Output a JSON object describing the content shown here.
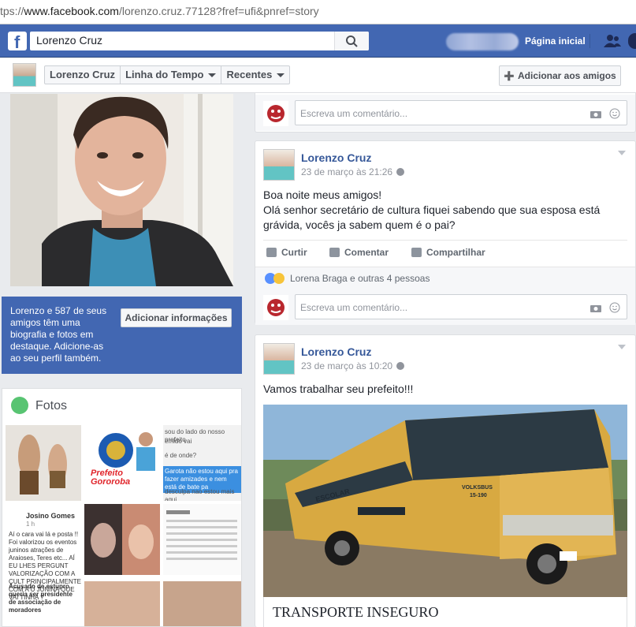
{
  "browser": {
    "url_scheme": "tps://",
    "url_host": "www.facebook.com",
    "url_path": "/lorenzo.cruz.77128?fref=ufi&pnref=story"
  },
  "topbar": {
    "logo": "f",
    "search_value": "Lorenzo Cruz",
    "home_label": "Página inicial",
    "icons": {
      "search": "search-icon",
      "friends": "friends-icon"
    }
  },
  "profile_nav": {
    "name": "Lorenzo Cruz",
    "timeline": "Linha do Tempo",
    "recent": "Recentes",
    "add_friend": "Adicionar aos amigos"
  },
  "intro": {
    "text": "Lorenzo e 587 de seus amigos têm uma biografia e fotos em destaque. Adicione-as ao seu perfil também.",
    "button": "Adicionar informações"
  },
  "photos": {
    "title": "Fotos",
    "tile_texts": {
      "prefeito": "Prefeito Gororoba",
      "post_top": "sou do lado do nosso prefeito",
      "post_top2": "emido vai",
      "post_top3": "é de onde?",
      "post_top4": "Garota não estou aqui pra fazer amizades e nem está de bate pa",
      "post_top5": "desculpa nao estou mais aqui",
      "josino": "Josino Gomes",
      "josino_time": "1 h",
      "josino_text": "Aí o cara vai lá e posta !! Foi valorizou os eventos juninos atrações de Araioses, Teres etc... AÍ EU LHES PERGUNT VALORIZAÇÃO COM A CULT PRINCIPALMENTE COM A Ú JUNINA QUE VAI TINHA ?",
      "acusado": "Acusado de estupro queria ser presidente de associação de moradores"
    }
  },
  "comment_placeholder": "Escreva um comentário...",
  "posts": [
    {
      "author": "Lorenzo Cruz",
      "time": "23 de março às 21:26",
      "text_line1": "Boa noite meus amigos!",
      "text_line2": "Olá senhor secretário de cultura fiquei sabendo que sua esposa está",
      "text_line3": "grávida, vocês ja sabem quem é o pai?",
      "actions": {
        "like": "Curtir",
        "comment": "Comentar",
        "share": "Compartilhar"
      },
      "reactions": "Lorena Braga e outras 4 pessoas"
    },
    {
      "author": "Lorenzo Cruz",
      "time": "23 de março às 10:20",
      "text": "Vamos trabalhar seu prefeito!!!",
      "bus_labels": {
        "escolar": "ESCOLAR",
        "volksbus": "VOLKSBUS",
        "model": "15-190"
      },
      "link_title": "TRANSPORTE INSEGURO"
    }
  ]
}
